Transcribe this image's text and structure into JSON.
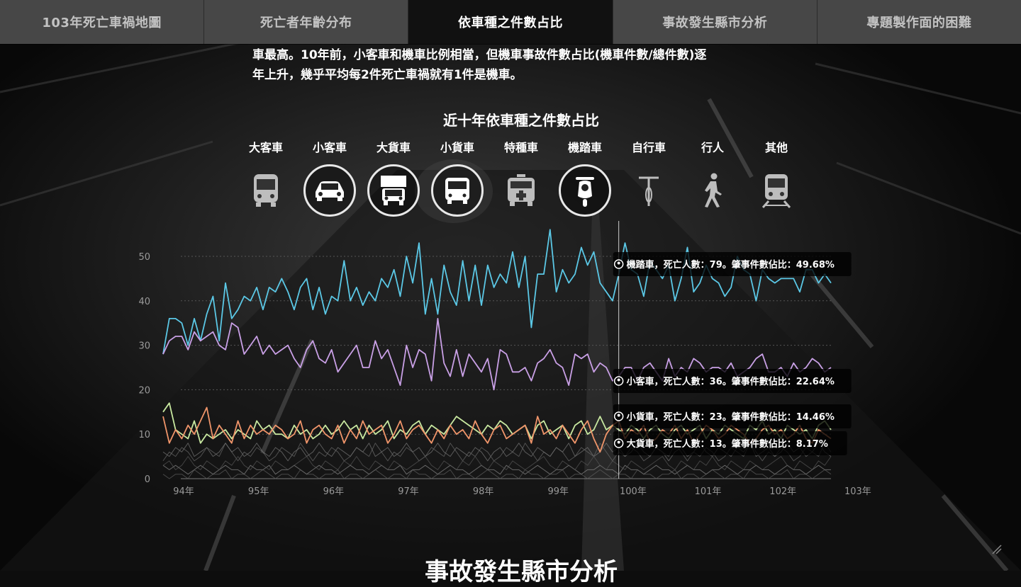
{
  "nav": {
    "tabs": [
      {
        "label": "103年死亡車禍地圖",
        "active": false
      },
      {
        "label": "死亡者年齡分布",
        "active": false
      },
      {
        "label": "依車種之件數占比",
        "active": true
      },
      {
        "label": "事故發生縣市分析",
        "active": false
      },
      {
        "label": "專題製作面的困難",
        "active": false
      }
    ]
  },
  "intro": {
    "line1": "車最高。10年前，小客車和機車比例相當，但機車事故件數占比(機車件數/總件數)逐",
    "line2": "年上升，幾乎平均每2件死亡車禍就有1件是機車。"
  },
  "filters": [
    {
      "label": "大客車",
      "icon": "bus-icon",
      "selected": false
    },
    {
      "label": "小客車",
      "icon": "car-icon",
      "selected": true
    },
    {
      "label": "大貨車",
      "icon": "truck-icon",
      "selected": true
    },
    {
      "label": "小貨車",
      "icon": "van-icon",
      "selected": true
    },
    {
      "label": "特種車",
      "icon": "ambulance-icon",
      "selected": false
    },
    {
      "label": "機踏車",
      "icon": "scooter-icon",
      "selected": true
    },
    {
      "label": "自行車",
      "icon": "bicycle-icon",
      "selected": false
    },
    {
      "label": "行人",
      "icon": "pedestrian-icon",
      "selected": false
    },
    {
      "label": "其他",
      "icon": "train-icon",
      "selected": false
    }
  ],
  "chart_data": {
    "type": "line",
    "title": "近十年依車種之件數占比",
    "xlabel": "",
    "ylabel": "",
    "ylim": [
      0,
      57
    ],
    "x_ticks": [
      "94年",
      "95年",
      "96年",
      "97年",
      "98年",
      "99年",
      "100年",
      "101年",
      "102年",
      "103年"
    ],
    "y_ticks": [
      0,
      10,
      20,
      30,
      40,
      50
    ],
    "grid": true,
    "months_per_year": 12,
    "start_year": 94,
    "hover_index": 73,
    "series": [
      {
        "name": "機踏車",
        "color": "#5bc8e6",
        "highlight": true,
        "values": [
          28,
          36,
          36,
          35,
          30,
          36,
          31,
          37,
          41,
          31,
          44,
          36,
          38,
          41,
          40,
          43,
          38,
          43,
          42,
          45,
          42,
          38,
          43,
          45,
          38,
          43,
          37,
          41,
          40,
          49,
          40,
          43,
          39,
          42,
          40,
          45,
          43,
          47,
          41,
          50,
          44,
          53,
          37,
          45,
          37,
          48,
          42,
          39,
          49,
          40,
          48,
          39,
          48,
          43,
          46,
          44,
          51,
          43,
          50,
          34,
          46,
          46,
          56,
          42,
          47,
          44,
          46,
          52,
          48,
          51,
          44,
          42,
          40,
          46,
          53,
          47,
          46,
          41,
          49,
          47,
          45,
          48,
          40,
          45,
          52,
          42,
          44,
          48,
          45,
          44,
          41,
          43,
          50,
          47,
          46,
          40,
          47,
          45,
          44,
          45,
          45,
          45,
          42,
          47,
          47,
          44,
          46,
          44
        ]
      },
      {
        "name": "小客車",
        "color": "#c9a0e6",
        "highlight": true,
        "values": [
          28,
          31,
          32,
          32,
          29,
          33,
          31,
          32,
          33,
          30,
          29,
          35,
          34,
          28,
          30,
          32,
          28,
          30,
          28,
          29,
          30,
          27,
          25,
          29,
          31,
          27,
          26,
          29,
          24,
          26,
          28,
          30,
          25,
          25,
          31,
          27,
          29,
          25,
          21,
          30,
          25,
          29,
          28,
          22,
          36,
          26,
          23,
          29,
          23,
          28,
          26,
          24,
          27,
          20,
          29,
          28,
          24,
          24,
          25,
          22,
          26,
          27,
          29,
          26,
          25,
          21,
          28,
          27,
          28,
          24,
          26,
          25,
          22,
          23,
          25,
          25,
          22,
          25,
          26,
          24,
          22,
          27,
          23,
          25,
          24,
          27,
          26,
          24,
          25,
          25,
          24,
          26,
          23,
          24,
          25,
          27,
          28,
          24,
          24,
          25,
          23,
          26,
          24,
          25,
          27,
          26,
          24,
          25
        ]
      },
      {
        "name": "小貨車",
        "color": "#c8e8a0",
        "highlight": true,
        "values": [
          15,
          17,
          11,
          10,
          9,
          13,
          8,
          10,
          9,
          10,
          11,
          9,
          11,
          10,
          9,
          13,
          11,
          12,
          10,
          10,
          9,
          12,
          10,
          11,
          9,
          10,
          12,
          10,
          11,
          13,
          11,
          12,
          9,
          12,
          10,
          11,
          13,
          9,
          11,
          10,
          12,
          13,
          10,
          12,
          11,
          10,
          12,
          14,
          13,
          12,
          11,
          10,
          12,
          11,
          13,
          12,
          10,
          11,
          12,
          9,
          12,
          13,
          10,
          11,
          12,
          9,
          12,
          13,
          10,
          11,
          14,
          11,
          12,
          11,
          10,
          12,
          11,
          9,
          11,
          12,
          10,
          9,
          11,
          12,
          10,
          11,
          12,
          9,
          11,
          10,
          12,
          11,
          10,
          9,
          12,
          11,
          13,
          10,
          11,
          9,
          12,
          11,
          10,
          11,
          9,
          12,
          13,
          11
        ]
      },
      {
        "name": "大貨車",
        "color": "#f0956a",
        "highlight": true,
        "values": [
          14,
          8,
          11,
          9,
          12,
          10,
          13,
          16,
          9,
          12,
          10,
          8,
          13,
          9,
          12,
          10,
          11,
          10,
          12,
          11,
          9,
          10,
          13,
          8,
          11,
          12,
          10,
          9,
          12,
          8,
          11,
          9,
          13,
          10,
          11,
          12,
          8,
          10,
          13,
          9,
          11,
          12,
          10,
          8,
          11,
          9,
          12,
          10,
          11,
          9,
          13,
          10,
          8,
          11,
          12,
          9,
          10,
          11,
          12,
          8,
          14,
          10,
          11,
          9,
          12,
          10,
          8,
          11,
          13,
          9,
          6,
          10,
          12,
          13,
          9,
          11,
          10,
          12,
          8,
          9,
          11,
          10,
          12,
          9,
          11,
          8,
          10,
          12,
          11,
          9,
          10,
          12,
          11,
          10,
          8,
          9,
          11,
          12,
          10,
          11,
          9,
          10,
          12,
          9,
          8,
          11,
          10,
          9
        ]
      },
      {
        "name": "大客車",
        "color": "#8a8a8a",
        "highlight": false,
        "values": [
          3,
          2,
          3,
          2,
          1,
          2,
          3,
          2,
          1,
          2,
          3,
          2,
          2,
          1,
          3,
          2,
          2,
          3,
          1,
          2,
          2,
          3,
          2,
          1,
          2,
          3,
          2,
          2,
          1,
          2,
          3,
          2,
          2,
          1,
          2,
          3,
          2,
          2,
          3,
          1,
          2,
          2,
          3,
          2,
          1,
          2,
          3,
          2,
          2,
          1,
          2,
          3,
          2,
          2,
          1,
          3,
          2,
          2,
          1,
          2,
          3,
          2,
          1,
          2,
          2,
          3,
          2,
          1,
          2,
          2,
          3,
          2,
          2,
          1,
          3,
          2,
          2,
          1,
          2,
          3,
          2,
          2,
          1,
          2,
          3,
          2,
          2,
          1,
          2,
          2,
          3,
          2,
          1,
          2,
          2,
          3,
          2,
          2,
          1,
          2,
          3,
          2,
          2,
          1,
          2,
          3,
          2,
          2
        ]
      },
      {
        "name": "自行車",
        "color": "#777777",
        "highlight": false,
        "values": [
          6,
          5,
          7,
          6,
          8,
          5,
          6,
          7,
          5,
          6,
          8,
          6,
          7,
          5,
          6,
          8,
          6,
          5,
          7,
          6,
          4,
          6,
          7,
          5,
          6,
          8,
          6,
          5,
          7,
          6,
          5,
          7,
          6,
          8,
          5,
          6,
          7,
          5,
          6,
          8,
          6,
          7,
          5,
          6,
          8,
          6,
          5,
          7,
          6,
          5,
          7,
          6,
          4,
          6,
          7,
          5,
          6,
          8,
          6,
          5,
          7,
          6,
          5,
          7,
          6,
          8,
          5,
          6,
          7,
          5,
          6,
          8,
          6,
          7,
          5,
          6,
          8,
          6,
          5,
          7,
          6,
          4,
          6,
          7,
          5,
          6,
          8,
          6,
          5,
          7,
          6,
          5,
          7,
          6,
          8,
          5,
          6,
          7,
          5,
          6,
          8,
          6,
          7,
          5,
          6,
          8,
          6,
          5
        ]
      },
      {
        "name": "行人",
        "color": "#6a6a6a",
        "highlight": false,
        "values": [
          4,
          6,
          5,
          7,
          6,
          4,
          5,
          7,
          6,
          5,
          8,
          6,
          4,
          6,
          5,
          7,
          6,
          4,
          5,
          7,
          6,
          5,
          8,
          6,
          4,
          6,
          5,
          7,
          6,
          4,
          5,
          7,
          6,
          5,
          8,
          6,
          4,
          6,
          5,
          7,
          6,
          4,
          5,
          7,
          6,
          5,
          8,
          6,
          4,
          6,
          5,
          7,
          6,
          4,
          5,
          7,
          6,
          5,
          8,
          6,
          4,
          6,
          5,
          7,
          6,
          4,
          5,
          7,
          6,
          5,
          8,
          6,
          4,
          6,
          5,
          7,
          6,
          4,
          5,
          7,
          6,
          5,
          8,
          6,
          4,
          6,
          5,
          7,
          6,
          4,
          5,
          7,
          6,
          5,
          8,
          6,
          4,
          6,
          5,
          7,
          6,
          4,
          5,
          7,
          6,
          5,
          8,
          6
        ]
      },
      {
        "name": "特種車",
        "color": "#5e5e5e",
        "highlight": false,
        "values": [
          1,
          0,
          1,
          1,
          0,
          2,
          1,
          0,
          1,
          1,
          2,
          0,
          1,
          1,
          0,
          1,
          2,
          1,
          0,
          1,
          1,
          0,
          2,
          1,
          1,
          0,
          1,
          1,
          2,
          0,
          1,
          1,
          0,
          1,
          2,
          1,
          0,
          1,
          1,
          0,
          2,
          1,
          1,
          0,
          1,
          1,
          2,
          0,
          1,
          1,
          0,
          1,
          2,
          1,
          0,
          1,
          1,
          0,
          2,
          1,
          1,
          0,
          1,
          1,
          2,
          0,
          1,
          1,
          0,
          1,
          2,
          1,
          0,
          1,
          1,
          0,
          2,
          1,
          1,
          0,
          1,
          1,
          2,
          0,
          1,
          1,
          0,
          1,
          2,
          1,
          0,
          1,
          1,
          0,
          2,
          1,
          1,
          0,
          1,
          1,
          2,
          0,
          1,
          1,
          0,
          1,
          2,
          1
        ]
      },
      {
        "name": "其他",
        "color": "#555555",
        "highlight": false,
        "values": [
          3,
          4,
          2,
          3,
          5,
          3,
          2,
          4,
          3,
          2,
          4,
          3,
          5,
          3,
          2,
          4,
          3,
          2,
          4,
          3,
          2,
          3,
          4,
          5,
          3,
          2,
          4,
          3,
          2,
          4,
          3,
          5,
          3,
          2,
          4,
          3,
          2,
          4,
          3,
          2,
          3,
          4,
          5,
          3,
          2,
          4,
          3,
          2,
          4,
          3,
          5,
          3,
          2,
          4,
          3,
          2,
          4,
          3,
          2,
          3,
          4,
          5,
          3,
          2,
          4,
          3,
          2,
          4,
          3,
          5,
          3,
          2,
          4,
          3,
          2,
          4,
          3,
          2,
          3,
          4,
          5,
          3,
          2,
          4,
          3,
          2,
          4,
          3,
          5,
          3,
          2,
          4,
          3,
          2,
          4,
          3,
          2,
          3,
          4,
          5,
          3,
          2,
          4,
          3,
          2,
          4,
          3,
          5
        ]
      }
    ],
    "tooltips": [
      {
        "series": "機踏車",
        "text": "機踏車，死亡人數：79。肇事件數佔比：49.68%",
        "value": 49.68
      },
      {
        "series": "小客車",
        "text": "小客車，死亡人數：36。肇事件數佔比：22.64%",
        "value": 22.64
      },
      {
        "series": "小貨車",
        "text": "小貨車，死亡人數：23。肇事件數佔比：14.46%",
        "value": 14.46
      },
      {
        "series": "大貨車",
        "text": "大貨車，死亡人數：13。肇事件數佔比：8.17%",
        "value": 8.17
      }
    ]
  },
  "next_section": {
    "heading": "事故發生縣市分析"
  }
}
